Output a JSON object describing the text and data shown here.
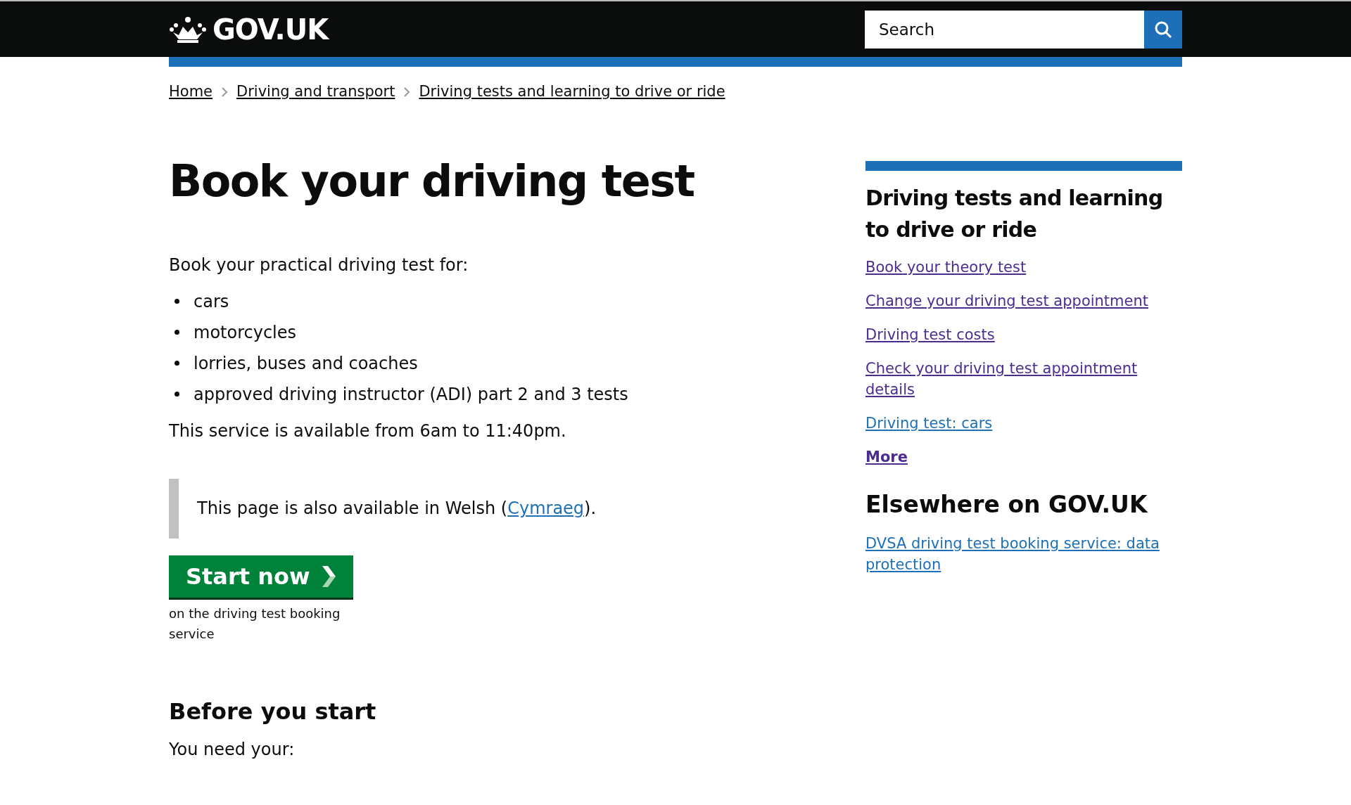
{
  "header": {
    "logo": "GOV.UK",
    "search": {
      "placeholder": "Search"
    }
  },
  "breadcrumbs": [
    "Home",
    "Driving and transport",
    "Driving tests and learning to drive or ride"
  ],
  "main": {
    "title": "Book your driving test",
    "intro": "Book your practical driving test for:",
    "list": [
      "cars",
      "motorcycles",
      "lorries, buses and coaches",
      "approved driving instructor (ADI) part 2 and 3 tests"
    ],
    "availability": "This service is available from 6am to 11:40pm.",
    "inset": {
      "before": "This page is also available in Welsh (",
      "link": "Cymraeg",
      "after": ")."
    },
    "start_button": "Start now",
    "start_note": "on the driving test booking service",
    "section_heading": "Before you start",
    "section_text": "You need your:"
  },
  "sidebar": {
    "title": "Driving tests and learning to drive or ride",
    "links": [
      {
        "label": "Book your theory test",
        "visited": true
      },
      {
        "label": "Change your driving test appointment",
        "visited": true
      },
      {
        "label": "Driving test costs",
        "visited": true
      },
      {
        "label": "Check your driving test appointment details",
        "visited": true
      },
      {
        "label": "Driving test: cars",
        "visited": false
      }
    ],
    "more": {
      "label": "More",
      "visited": true
    },
    "elsewhere_title": "Elsewhere on GOV.UK",
    "elsewhere_links": [
      {
        "label": "DVSA driving test booking service: data protection",
        "visited": false
      }
    ]
  }
}
